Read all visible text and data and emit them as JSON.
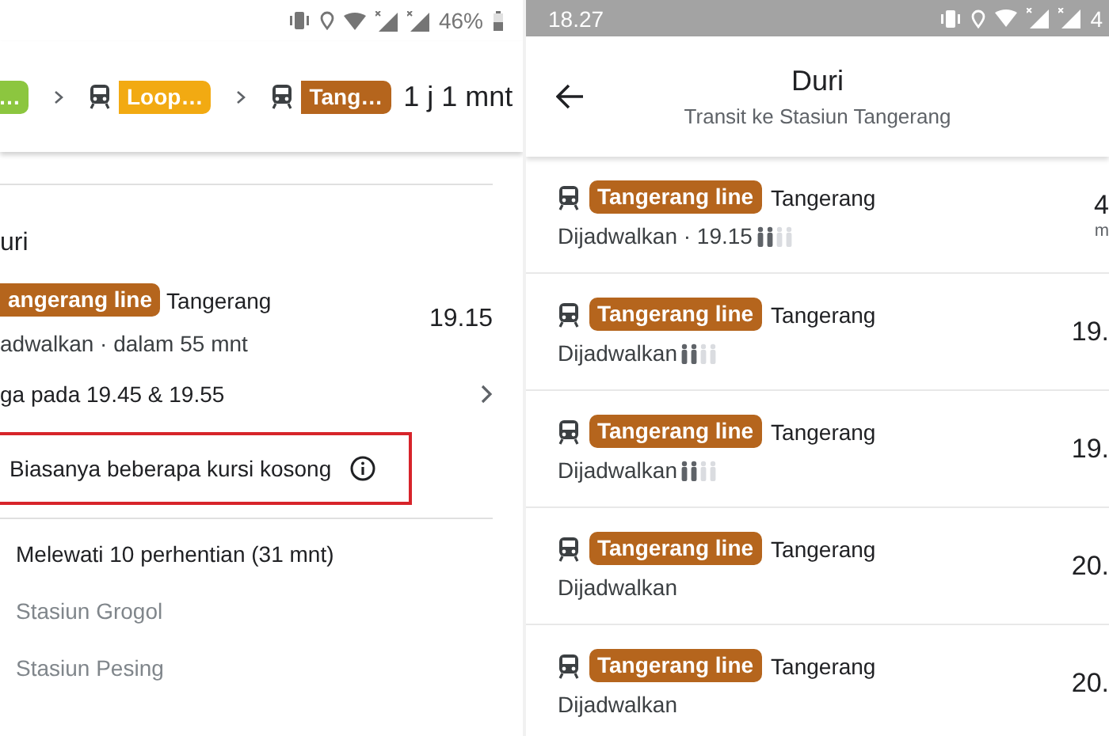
{
  "left_panel": {
    "status_bar": {
      "battery": "46%"
    },
    "route": {
      "steps": [
        {
          "label": "…",
          "color": "#8cc63f",
          "train_icon": false
        },
        {
          "label": "Loop…",
          "color": "#f2aa12",
          "train_icon": true
        },
        {
          "label": "Tang…",
          "color": "#b5651d",
          "train_icon": true
        }
      ],
      "duration": "1 j 1 mnt"
    },
    "stop": "uri",
    "line": {
      "label": "angerang line",
      "color": "#b5651d",
      "destination": "Tangerang"
    },
    "status": "adwalkan · dalam 55 mnt",
    "time": "19.15",
    "also": "ga pada 19.45 & 19.55",
    "crowding_note": {
      "text": "Biasanya beberapa kursi kosong",
      "highlighted": true
    },
    "stops_summary": "Melewati 10 perhentian (31 mnt)",
    "stops": [
      "Stasiun Grogol",
      "Stasiun Pesing"
    ]
  },
  "right_panel": {
    "status_bar": {
      "clock": "18.27",
      "battery": "4"
    },
    "header": {
      "title": "Duri",
      "subtitle": "Transit ke Stasiun Tangerang"
    },
    "departures": [
      {
        "line": "Tangerang line",
        "color": "#b5651d",
        "destination": "Tangerang",
        "status": "Dijadwalkan · 19.15",
        "crowding": true,
        "time": "4",
        "time_unit": "m"
      },
      {
        "line": "Tangerang line",
        "color": "#b5651d",
        "destination": "Tangerang",
        "status": "Dijadwalkan",
        "crowding": true,
        "time": "19."
      },
      {
        "line": "Tangerang line",
        "color": "#b5651d",
        "destination": "Tangerang",
        "status": "Dijadwalkan",
        "crowding": true,
        "time": "19."
      },
      {
        "line": "Tangerang line",
        "color": "#b5651d",
        "destination": "Tangerang",
        "status": "Dijadwalkan",
        "crowding": false,
        "time": "20."
      },
      {
        "line": "Tangerang line",
        "color": "#b5651d",
        "destination": "Tangerang",
        "status": "Dijadwalkan",
        "crowding": false,
        "time": "20."
      }
    ]
  }
}
